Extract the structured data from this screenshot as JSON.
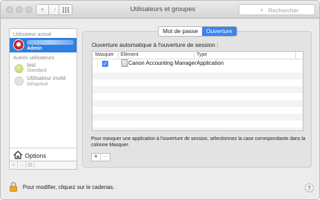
{
  "window": {
    "title": "Utilisateurs et groupes",
    "search_placeholder": "Rechercher",
    "nav_back_glyph": "‹",
    "nav_forward_glyph": "›"
  },
  "sidebar": {
    "current_user_heading": "Utilisateur actuel",
    "current_user": {
      "role": "Admin",
      "name_visible": false
    },
    "other_users_heading": "Autres utilisateurs",
    "users": [
      {
        "name": "test",
        "role": "Standard"
      },
      {
        "name": "Utilisateur invité",
        "role": "Désactivé"
      }
    ],
    "options_label": "Options",
    "bottom_buttons": [
      "+",
      "−",
      "⚙"
    ]
  },
  "tabs": [
    {
      "label": "Mot de passe",
      "active": false
    },
    {
      "label": "Ouverture",
      "active": true
    }
  ],
  "login_items": {
    "title": "Ouverture automatique à l'ouverture de session :",
    "columns": [
      "Masquer",
      "Élément",
      "Type"
    ],
    "rows": [
      {
        "hide": true,
        "item": "Canon Accounting Manager",
        "type": "Application"
      }
    ],
    "help_text": "Pour masquer une application à l'ouverture de session, sélectionnez la case correspondante dans la colonne Masquer.",
    "add_label": "+",
    "remove_label": "−"
  },
  "footer": {
    "lock_text": "Pour modifier, cliquez sur le cadenas.",
    "help_label": "?"
  },
  "colors": {
    "selection": "#2f7fe0",
    "accent": "#3a84f0",
    "admin_avatar": "#c8232c"
  }
}
